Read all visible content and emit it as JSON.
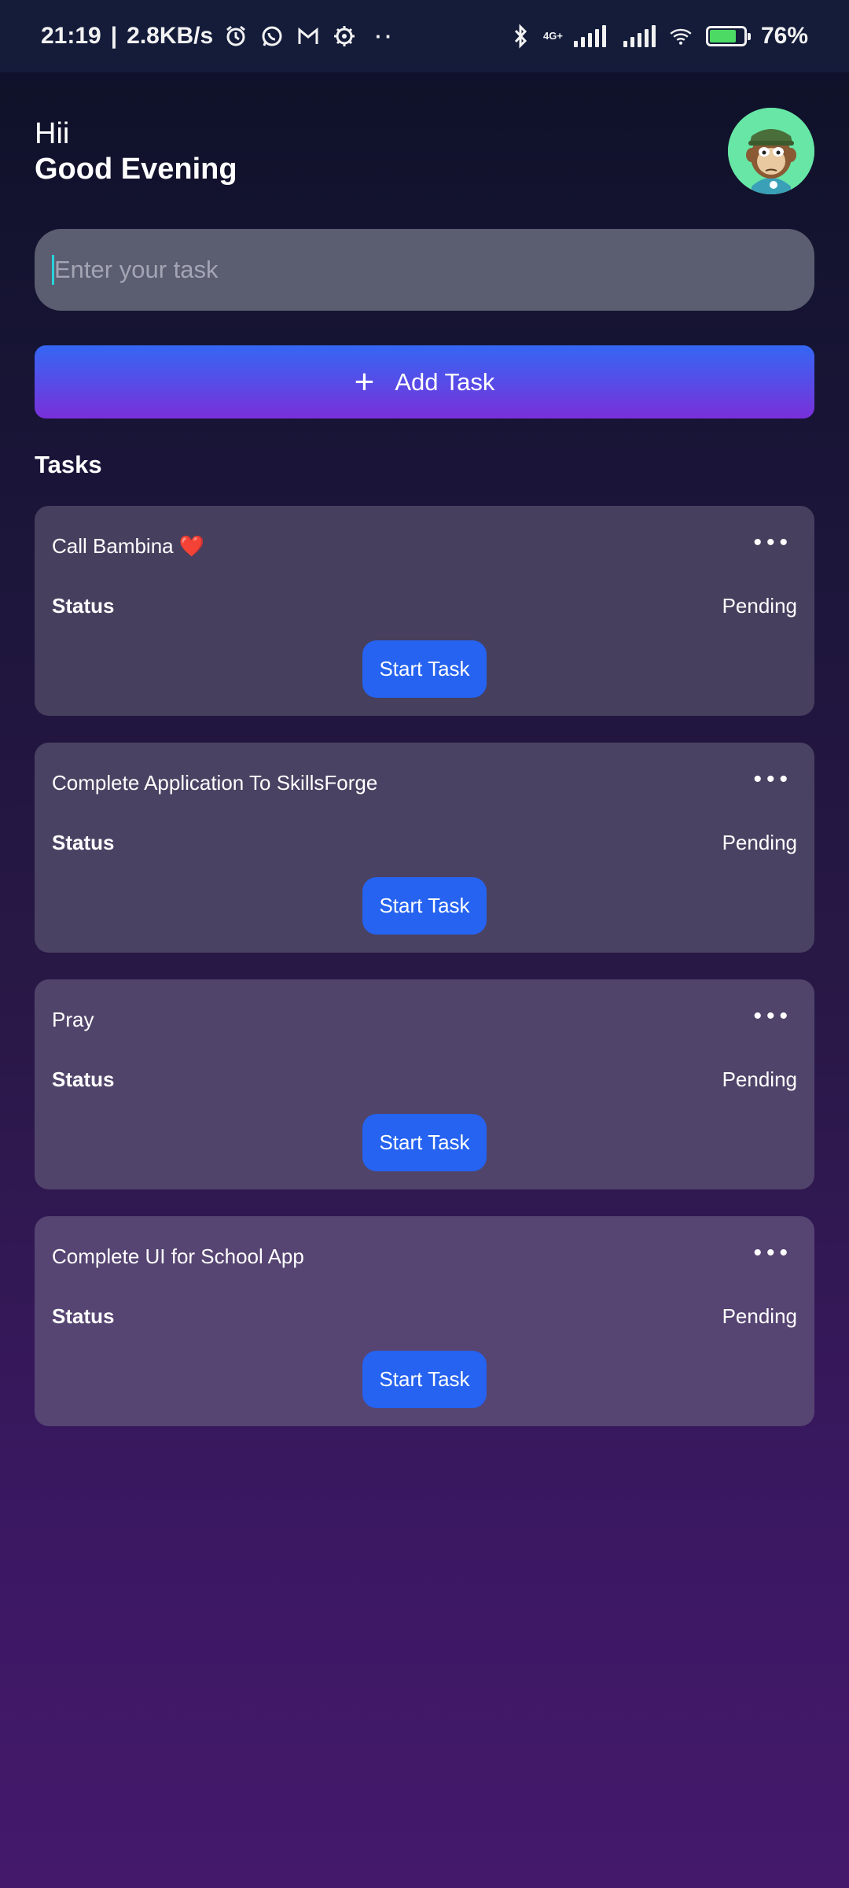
{
  "status_bar": {
    "time": "21:19",
    "speed": "2.8KB/s",
    "network": "4G+",
    "battery": "76%",
    "icons": [
      "alarm-icon",
      "whatsapp-icon",
      "gmail-icon",
      "settings-icon",
      "bluetooth-icon",
      "signal-icon",
      "wifi-icon",
      "battery-icon"
    ]
  },
  "greeting": {
    "small": "Hii",
    "big": "Good Evening"
  },
  "input": {
    "placeholder": "Enter your task"
  },
  "add_button": {
    "label": "Add Task"
  },
  "section": {
    "title": "Tasks"
  },
  "tasks": [
    {
      "title": "Call Bambina",
      "emoji": "❤️",
      "status_label": "Status",
      "status": "Pending",
      "button": "Start Task"
    },
    {
      "title": "Complete Application To SkillsForge",
      "emoji": "",
      "status_label": "Status",
      "status": "Pending",
      "button": "Start Task"
    },
    {
      "title": "Pray",
      "emoji": "",
      "status_label": "Status",
      "status": "Pending",
      "button": "Start Task"
    },
    {
      "title": "Complete UI for School App",
      "emoji": "",
      "status_label": "Status",
      "status": "Pending",
      "button": "Start Task"
    }
  ],
  "colors": {
    "accent": "#2563f0",
    "avatar_bg": "#67e6a6",
    "card_bg": "#4b4563"
  }
}
